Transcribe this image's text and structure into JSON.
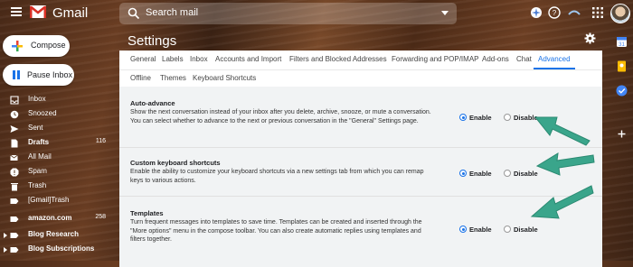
{
  "topbar": {
    "logo_text": "Gmail",
    "search_placeholder": "Search mail"
  },
  "nav": {
    "compose_label": "Compose",
    "pause_label": "Pause Inbox",
    "items": [
      {
        "label": "Inbox",
        "count": "",
        "bold": false,
        "icon": "inbox-icon"
      },
      {
        "label": "Snoozed",
        "count": "",
        "bold": false,
        "icon": "clock-icon"
      },
      {
        "label": "Sent",
        "count": "",
        "bold": false,
        "icon": "send-icon"
      },
      {
        "label": "Drafts",
        "count": "116",
        "bold": true,
        "icon": "draft-icon"
      },
      {
        "label": "All Mail",
        "count": "",
        "bold": false,
        "icon": "all-mail-icon"
      },
      {
        "label": "Spam",
        "count": "",
        "bold": false,
        "icon": "spam-icon"
      },
      {
        "label": "Trash",
        "count": "",
        "bold": false,
        "icon": "trash-icon"
      },
      {
        "label": "[Gmail]Trash",
        "count": "",
        "bold": false,
        "icon": "label-icon"
      },
      {
        "label": "amazon.com",
        "count": "258",
        "bold": true,
        "icon": "label-icon"
      },
      {
        "label": "Blog Research",
        "count": "",
        "bold": true,
        "icon": "label-icon"
      },
      {
        "label": "Blog Subscriptions",
        "count": "",
        "bold": true,
        "icon": "label-icon"
      }
    ]
  },
  "settings": {
    "title": "Settings",
    "tabs_row1": [
      "General",
      "Labels",
      "Inbox",
      "Accounts and Import",
      "Filters and Blocked Addresses",
      "Forwarding and POP/IMAP",
      "Add-ons",
      "Chat",
      "Advanced"
    ],
    "tabs_row2": [
      "Offline",
      "Themes",
      "Keyboard Shortcuts"
    ],
    "active_tab": "Advanced",
    "sections": [
      {
        "title": "Auto-advance",
        "desc": "Show the next conversation instead of your inbox after you delete, archive, snooze, or mute a conversation. You can select whether to advance to the next or previous conversation in the \"General\" Settings page.",
        "enable_label": "Enable",
        "disable_label": "Disable",
        "selected": "enable"
      },
      {
        "title": "Custom keyboard shortcuts",
        "desc": "Enable the ability to customize your keyboard shortcuts via a new settings tab from which you can remap keys to various actions.",
        "enable_label": "Enable",
        "disable_label": "Disable",
        "selected": "enable"
      },
      {
        "title": "Templates",
        "desc": "Turn frequent messages into templates to save time. Templates can be created and inserted through the \"More options\" menu in the compose toolbar. You can also create automatic replies using templates and filters together.",
        "enable_label": "Enable",
        "disable_label": "Disable",
        "selected": "enable"
      }
    ]
  },
  "colors": {
    "accent": "#1a73e8",
    "annotation_arrow": "#3aa58b"
  }
}
